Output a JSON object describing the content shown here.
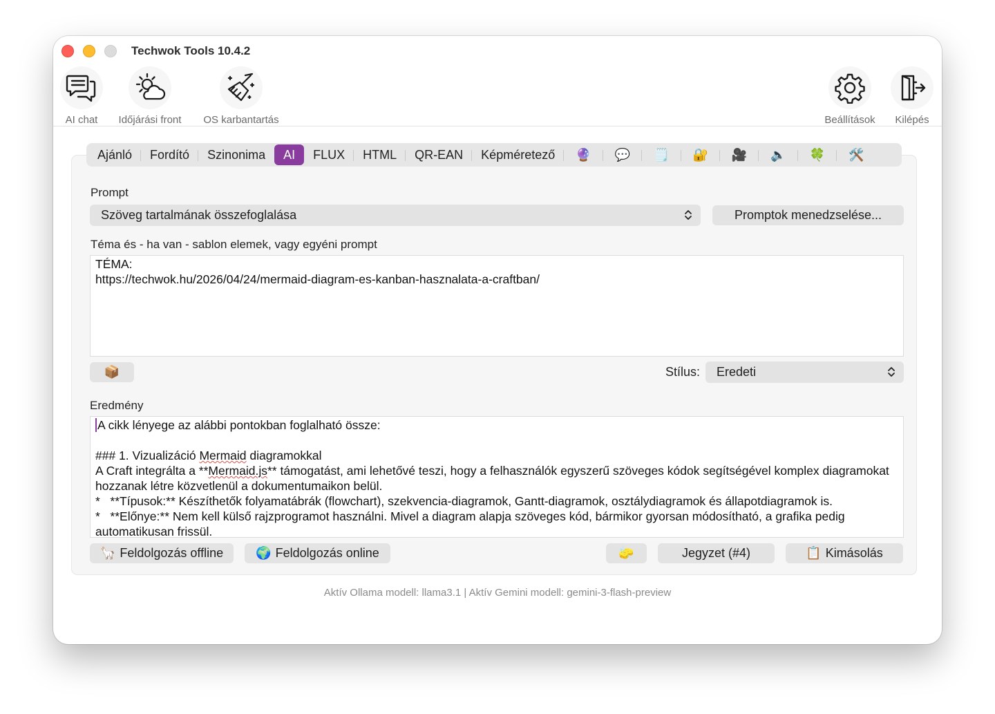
{
  "window": {
    "title": "Techwok Tools 10.4.2"
  },
  "toolbar": {
    "left": [
      {
        "label": "AI chat",
        "icon": "chat-bubbles-icon"
      },
      {
        "label": "Időjárási front",
        "icon": "weather-sun-cloud-icon"
      },
      {
        "label": "OS karbantartás",
        "icon": "broom-sparkle-icon"
      }
    ],
    "right": [
      {
        "label": "Beállítások",
        "icon": "gear-icon"
      },
      {
        "label": "Kilépés",
        "icon": "exit-door-icon"
      }
    ]
  },
  "tabs": {
    "text": [
      "Ajánló",
      "Fordító",
      "Szinonima",
      "AI",
      "FLUX",
      "HTML",
      "QR-EAN",
      "Képméretező"
    ],
    "active": "AI",
    "icons": [
      {
        "name": "crystal-ball-icon",
        "glyph": "🔮"
      },
      {
        "name": "speech-bubble-icon",
        "glyph": "💬"
      },
      {
        "name": "notepad-icon",
        "glyph": "🗒️"
      },
      {
        "name": "lock-icon",
        "glyph": "🔐"
      },
      {
        "name": "movie-camera-icon",
        "glyph": "🎥"
      },
      {
        "name": "speaker-icon",
        "glyph": "🔈"
      },
      {
        "name": "clover-icon",
        "glyph": "🍀"
      },
      {
        "name": "tools-icon",
        "glyph": "🛠️"
      }
    ]
  },
  "prompt": {
    "label": "Prompt",
    "selected": "Szöveg tartalmának összefoglalása",
    "manage_button": "Promptok menedzselése..."
  },
  "topic": {
    "label": "Téma és - ha van - sablon elemek, vagy egyéni prompt",
    "value": "TÉMA:\nhttps://techwok.hu/2026/04/24/mermaid-diagram-es-kanban-hasznalata-a-craftban/"
  },
  "package_button": {
    "glyph": "📦",
    "icon": "package-icon"
  },
  "style": {
    "label": "Stílus:",
    "selected": "Eredeti"
  },
  "result": {
    "label": "Eredmény",
    "line1": "A cikk lényege az alábbi pontokban foglalható össze:",
    "line2_pre": "### 1. Vizualizáció ",
    "line2_spell": "Mermaid",
    "line2_post": " diagramokkal",
    "line3_pre": "A Craft integrálta a **",
    "line3_spell": "Mermaid.js",
    "line3_post": "** támogatást, ami lehetővé teszi, hogy a felhasználók egyszerű szöveges kódok segítségével komplex diagramokat hozzanak létre közvetlenül a dokumentumaikon belül.",
    "line4": "*   **Típusok:** Készíthetők folyamatábrák (flowchart), szekvencia-diagramok, Gantt-diagramok, osztálydiagramok és állapotdiagramok is.",
    "line5": "*   **Előnye:** Nem kell külső rajzprogramot használni. Mivel a diagram alapja szöveges kód, bármikor gyorsan módosítható, a grafika pedig automatikusan frissül."
  },
  "actions": {
    "offline": {
      "glyph": "🦙",
      "label": "Feldolgozás offline"
    },
    "online": {
      "glyph": "🌍",
      "label": "Feldolgozás online"
    },
    "clear": {
      "glyph": "🧽"
    },
    "note": {
      "label": "Jegyzet (#4)"
    },
    "copy": {
      "glyph": "📋",
      "label": "Kimásolás"
    }
  },
  "status": {
    "text": "Aktív Ollama modell: llama3.1 | Aktív Gemini modell: gemini-3-flash-preview"
  }
}
